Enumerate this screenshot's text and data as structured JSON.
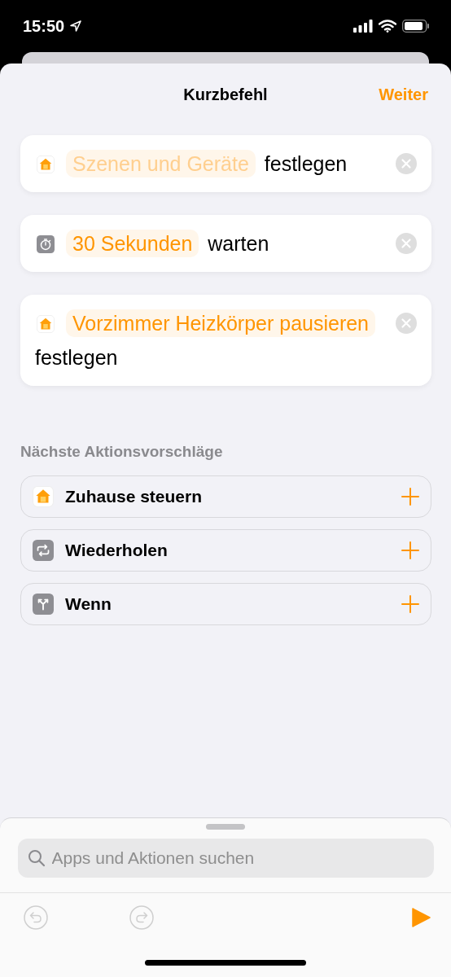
{
  "status_bar": {
    "time": "15:50"
  },
  "nav": {
    "title": "Kurzbefehl",
    "action": "Weiter"
  },
  "actions": [
    {
      "kind": "home",
      "parameter": "Szenen und Geräte",
      "unset": true,
      "verb": "festlegen"
    },
    {
      "kind": "timer",
      "parameter": "30 Sekunden",
      "unset": false,
      "verb": "warten"
    },
    {
      "kind": "home",
      "parameter": "Vorzimmer Heizkörper pausieren",
      "unset": false,
      "verb": "festlegen"
    }
  ],
  "suggestions": {
    "title": "Nächste Aktionsvorschläge",
    "items": [
      {
        "kind": "home",
        "label": "Zuhause steuern"
      },
      {
        "kind": "repeat",
        "label": "Wiederholen"
      },
      {
        "kind": "branch",
        "label": "Wenn"
      }
    ]
  },
  "search": {
    "placeholder": "Apps und Aktionen suchen"
  },
  "toolbar": {
    "undo_disabled": true,
    "redo_disabled": true
  }
}
